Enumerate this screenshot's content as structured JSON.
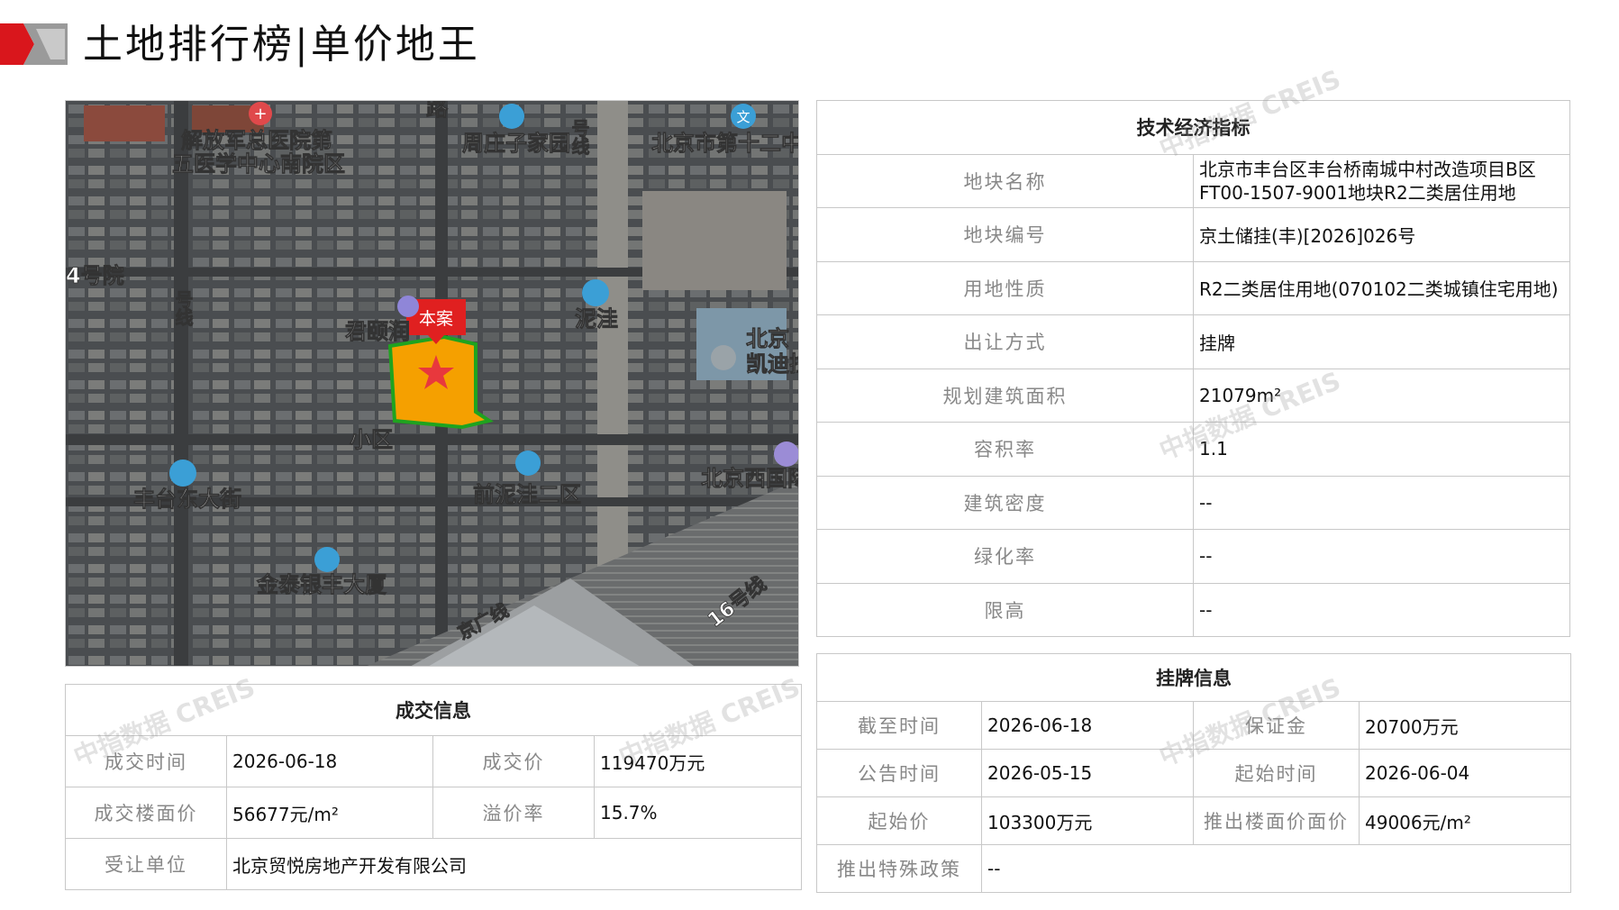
{
  "header": {
    "title": "土地排行榜|单价地王"
  },
  "map": {
    "marker_label": "本案",
    "labels": {
      "hospital": "解放军总医院第",
      "hospital2": "五医学中心南院区",
      "road_top": "路",
      "zhouzhuang": "周庄子家园",
      "line_top": "号线",
      "school": "北京市第十二中",
      "no4": "4号院",
      "line9": "号线",
      "junlin": "君颐润",
      "nihe": "泥洼",
      "beijing_right": "北京",
      "kaidi": "凯迪拉",
      "xiaoqu": "小区",
      "fengtaidong": "丰台东大街",
      "qianniwa": "前泥洼二区",
      "beijingxi": "北京西国际",
      "jintai": "金泰银丰大厦",
      "jingguang": "京广线",
      "line16": "16号线"
    },
    "colors": {
      "parcel": "#f5a000",
      "parcel_border": "#1fa31f",
      "marker": "#e02020"
    }
  },
  "watermark": "中指数据 CREIS",
  "tech": {
    "header": "技术经济指标",
    "rows": [
      {
        "label": "地块名称",
        "value": "北京市丰台区丰台桥南城中村改造项目B区FT00-1507-9001地块R2二类居住用地"
      },
      {
        "label": "地块编号",
        "value": "京土储挂(丰)[2026]026号"
      },
      {
        "label": "用地性质",
        "value": "R2二类居住用地(070102二类城镇住宅用地)"
      },
      {
        "label": "出让方式",
        "value": "挂牌"
      },
      {
        "label": "规划建筑面积",
        "value": "21079m²"
      },
      {
        "label": "容积率",
        "value": "1.1"
      },
      {
        "label": "建筑密度",
        "value": "--"
      },
      {
        "label": "绿化率",
        "value": "--"
      },
      {
        "label": "限高",
        "value": "--"
      }
    ]
  },
  "listing": {
    "header": "挂牌信息",
    "rows": [
      {
        "l1": "截至时间",
        "v1": "2026-06-18",
        "l2": "保证金",
        "v2": "20700万元"
      },
      {
        "l1": "公告时间",
        "v1": "2026-05-15",
        "l2": "起始时间",
        "v2": "2026-06-04"
      },
      {
        "l1": "起始价",
        "v1": "103300万元",
        "l2": "推出楼面价面价",
        "v2": "49006元/m²"
      }
    ],
    "policy": {
      "label": "推出特殊政策",
      "value": "--"
    }
  },
  "deal": {
    "header": "成交信息",
    "rows": [
      {
        "l1": "成交时间",
        "v1": "2026-06-18",
        "l2": "成交价",
        "v2": "119470万元"
      },
      {
        "l1": "成交楼面价",
        "v1": "56677元/m²",
        "l2": "溢价率",
        "v2": "15.7%"
      }
    ],
    "buyer": {
      "label": "受让单位",
      "value": "北京贸悦房地产开发有限公司"
    }
  }
}
